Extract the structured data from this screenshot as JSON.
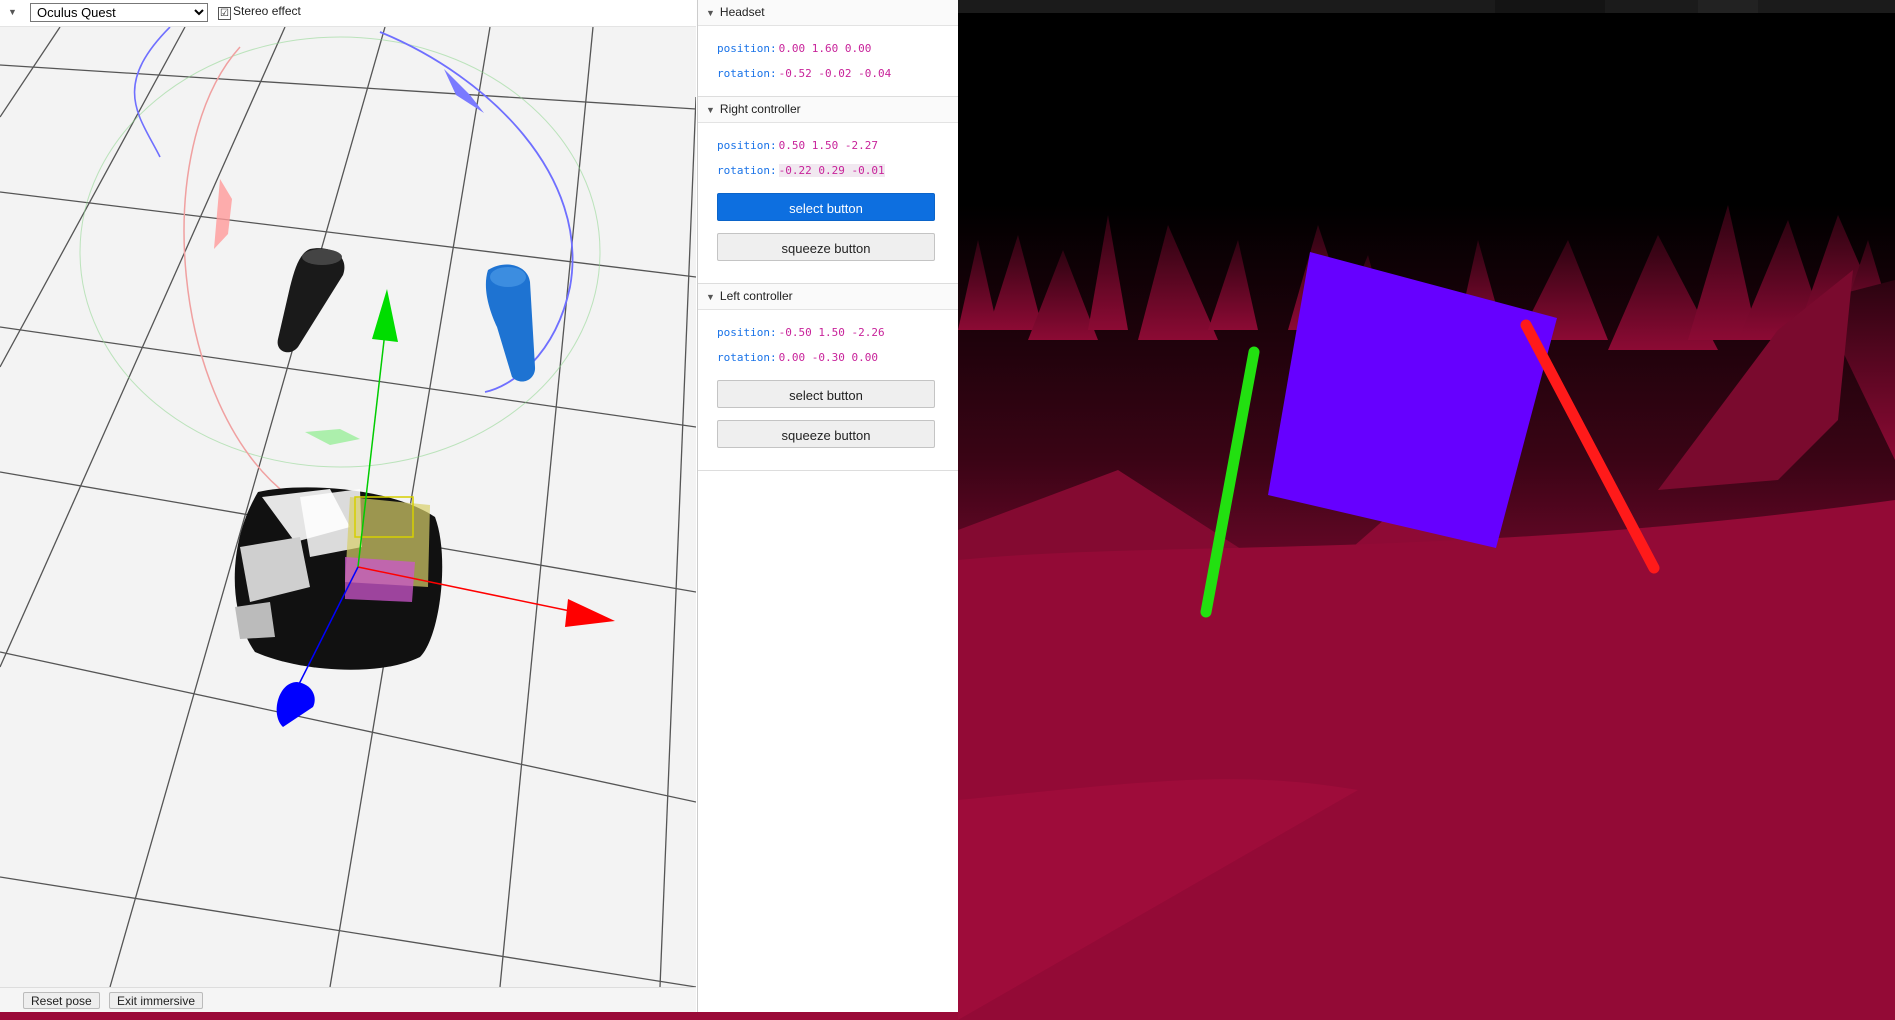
{
  "emulator": {
    "device_options": [
      "Oculus Quest"
    ],
    "device_selected": "Oculus Quest",
    "stereo_label": "Stereo effect",
    "stereo_checked": true,
    "stereo_check_glyph": "☑",
    "collapse_icon_glyph": "▼",
    "reset_pose_label": "Reset pose",
    "exit_immersive_label": "Exit immersive"
  },
  "inspector": {
    "headset": {
      "title": "Headset",
      "position_label": "position:",
      "position_value": "0.00 1.60 0.00",
      "rotation_label": "rotation:",
      "rotation_value": "-0.52 -0.02 -0.04"
    },
    "right_controller": {
      "title": "Right controller",
      "position_label": "position:",
      "position_value": "0.50 1.50 -2.27",
      "rotation_label": "rotation:",
      "rotation_value": "-0.22 0.29 -0.01",
      "select_label": "select button",
      "select_pressed": true,
      "squeeze_label": "squeeze button"
    },
    "left_controller": {
      "title": "Left controller",
      "position_label": "position:",
      "position_value": "-0.50 1.50 -2.26",
      "rotation_label": "rotation:",
      "rotation_value": "0.00 -0.30 0.00",
      "select_label": "select button",
      "squeeze_label": "squeeze button"
    },
    "section_toggle_glyph": "▼"
  },
  "colors": {
    "axis_x": "#ff0000",
    "axis_y": "#00cc00",
    "axis_z": "#0000ff",
    "right_controller_model": "#1e73d2",
    "left_controller_model": "#1a1a1a",
    "xr_cube": "#6600ff",
    "xr_left_stick": "#22e010",
    "xr_right_stick": "#ff1a1a",
    "xr_ground": "#9a0a38",
    "xr_sky": "#000000",
    "pressed_button": "#0d6fe0"
  },
  "icons": {
    "collapse": "triangle-down-icon",
    "checkbox": "checkbox-checked-icon",
    "section_toggle": "triangle-down-icon"
  }
}
